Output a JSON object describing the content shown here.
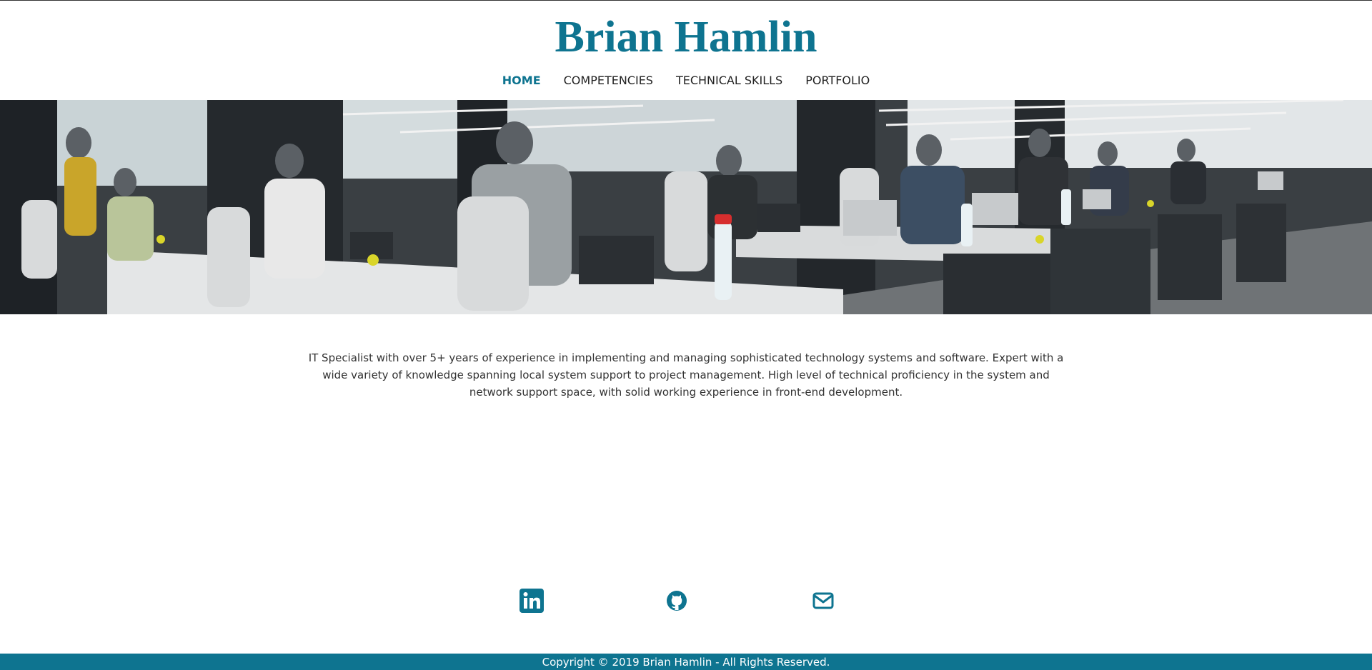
{
  "site": {
    "title": "Brian Hamlin"
  },
  "nav": {
    "items": [
      {
        "label": "HOME",
        "active": true
      },
      {
        "label": "COMPETENCIES",
        "active": false
      },
      {
        "label": "TECHNICAL SKILLS",
        "active": false
      },
      {
        "label": "PORTFOLIO",
        "active": false
      }
    ]
  },
  "hero": {
    "image": "open-office-coworking-photo"
  },
  "bio": {
    "text": "IT Specialist with over 5+ years of experience in implementing and managing sophisticated technology systems and software. Expert with a wide variety of knowledge spanning local system support to project management. High level of technical proficiency in the system and network support space, with solid working experience in front-end development."
  },
  "social": {
    "links": [
      {
        "icon": "linkedin-icon"
      },
      {
        "icon": "github-icon"
      },
      {
        "icon": "email-icon"
      }
    ]
  },
  "footer": {
    "text": "Copyright © 2019 Brian Hamlin - All Rights Reserved."
  },
  "colors": {
    "accent": "#0e7490",
    "text": "#333333",
    "footer_bg": "#0e7490"
  }
}
